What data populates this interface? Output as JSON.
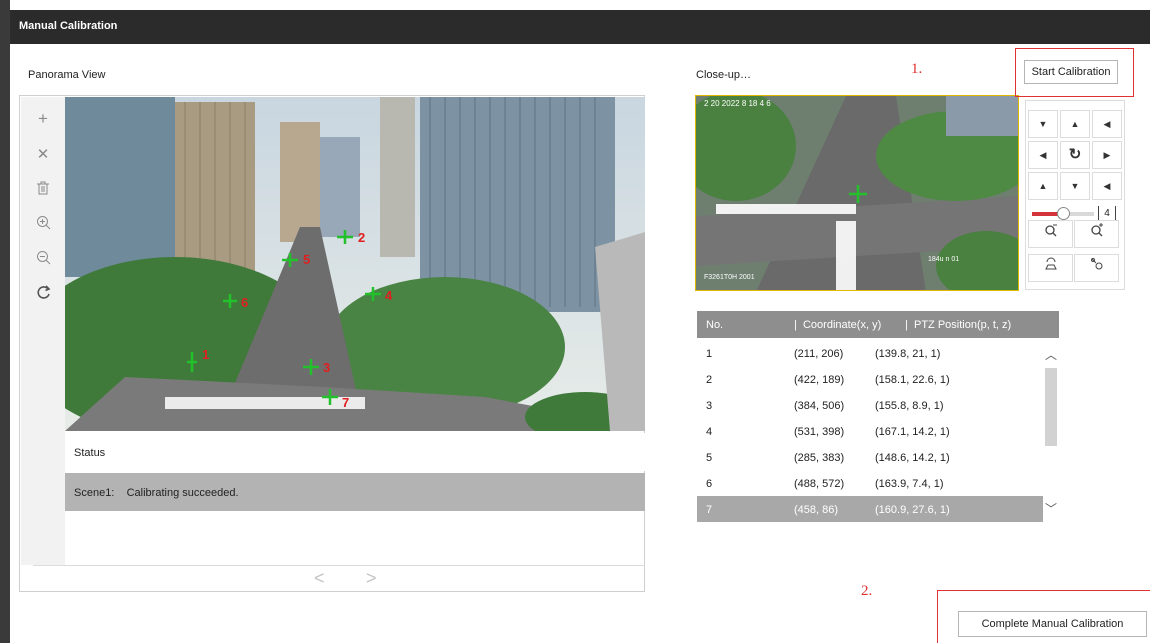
{
  "window": {
    "title": "Manual Calibration"
  },
  "panorama": {
    "label": "Panorama View",
    "tools": [
      "plus-icon",
      "close-icon",
      "delete-icon",
      "zoom-in-icon",
      "zoom-out-icon",
      "refresh-icon"
    ],
    "markers": [
      "1",
      "2",
      "3",
      "4",
      "5",
      "6",
      "7"
    ],
    "status_header": "Status",
    "status_scene": "Scene1:",
    "status_message": "Calibrating succeeded.",
    "prev_label": "<",
    "next_label": ">"
  },
  "closeup": {
    "label": "Close-up…",
    "osd_top": "2 20  2022   8  18  4  6",
    "osd_left": "F3261T0H    2001",
    "osd_right": "184u  n  01"
  },
  "ptz": {
    "directions": [
      "up-left",
      "up",
      "up-right",
      "left",
      "auto-rotate",
      "right",
      "down-left",
      "down",
      "down-right"
    ],
    "speed": "4",
    "speed_fraction": 0.5
  },
  "start_button": "Start Calibration",
  "complete_button": "Complete Manual Calibration",
  "annotations": {
    "one": "1.",
    "two": "2."
  },
  "table": {
    "headers": [
      "No.",
      "Coordinate(x, y)",
      "PTZ Position(p, t, z)"
    ],
    "rows": [
      {
        "no": "1",
        "coord": "(211, 206)",
        "ptz": "(139.8, 21, 1)"
      },
      {
        "no": "2",
        "coord": "(422, 189)",
        "ptz": "(158.1, 22.6, 1)"
      },
      {
        "no": "3",
        "coord": "(384, 506)",
        "ptz": "(155.8, 8.9, 1)"
      },
      {
        "no": "4",
        "coord": "(531, 398)",
        "ptz": "(167.1, 14.2, 1)"
      },
      {
        "no": "5",
        "coord": "(285, 383)",
        "ptz": "(148.6, 14.2, 1)"
      },
      {
        "no": "6",
        "coord": "(488, 572)",
        "ptz": "(163.9, 7.4, 1)"
      },
      {
        "no": "7",
        "coord": "(458, 86)",
        "ptz": "(160.9, 27.6, 1)"
      }
    ],
    "selected_row": "7"
  },
  "colors": {
    "accent_red": "#e03030",
    "marker_green": "#22c02a",
    "marker_red": "#e02020",
    "closeup_border": "#e0b800"
  }
}
